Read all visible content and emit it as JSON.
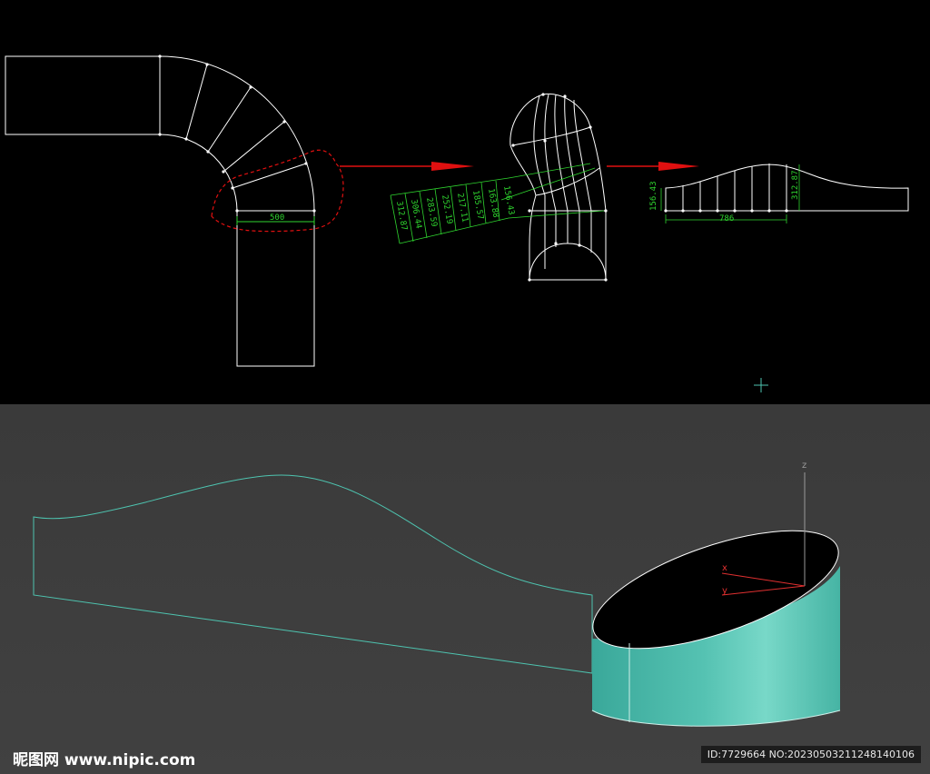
{
  "viewports": {
    "top": {
      "name": "Top viewport (2D CAD)",
      "background": "#000000"
    },
    "bottom": {
      "name": "Perspective viewport (3D)",
      "background": "#3d3d3d"
    }
  },
  "colors": {
    "line": "#ffffff",
    "dimension": "#2fd52f",
    "arrow": "#e01010",
    "selection": "#e01010",
    "mesh": "#6cd0c0",
    "spline": "#4ec4b0",
    "axis_x": "#e03030",
    "axis_y": "#e03030"
  },
  "dimensions": {
    "pipe_width": "500",
    "unroll_length": "786",
    "unroll_height_left": "156.43",
    "unroll_height_right": "312.87",
    "strip_values": [
      "312.87",
      "306.44",
      "283.59",
      "252.19",
      "217.11",
      "185.57",
      "163.88",
      "156.43"
    ]
  },
  "axis_labels": {
    "z": "z",
    "x": "x",
    "y": "y"
  },
  "icons": {
    "cursor": "crosshair-icon",
    "arrow": "arrow-right-icon"
  },
  "watermark": {
    "left": "昵图网 www.nipic.com",
    "right": "ID:7729664 NO:20230503211248140106"
  }
}
